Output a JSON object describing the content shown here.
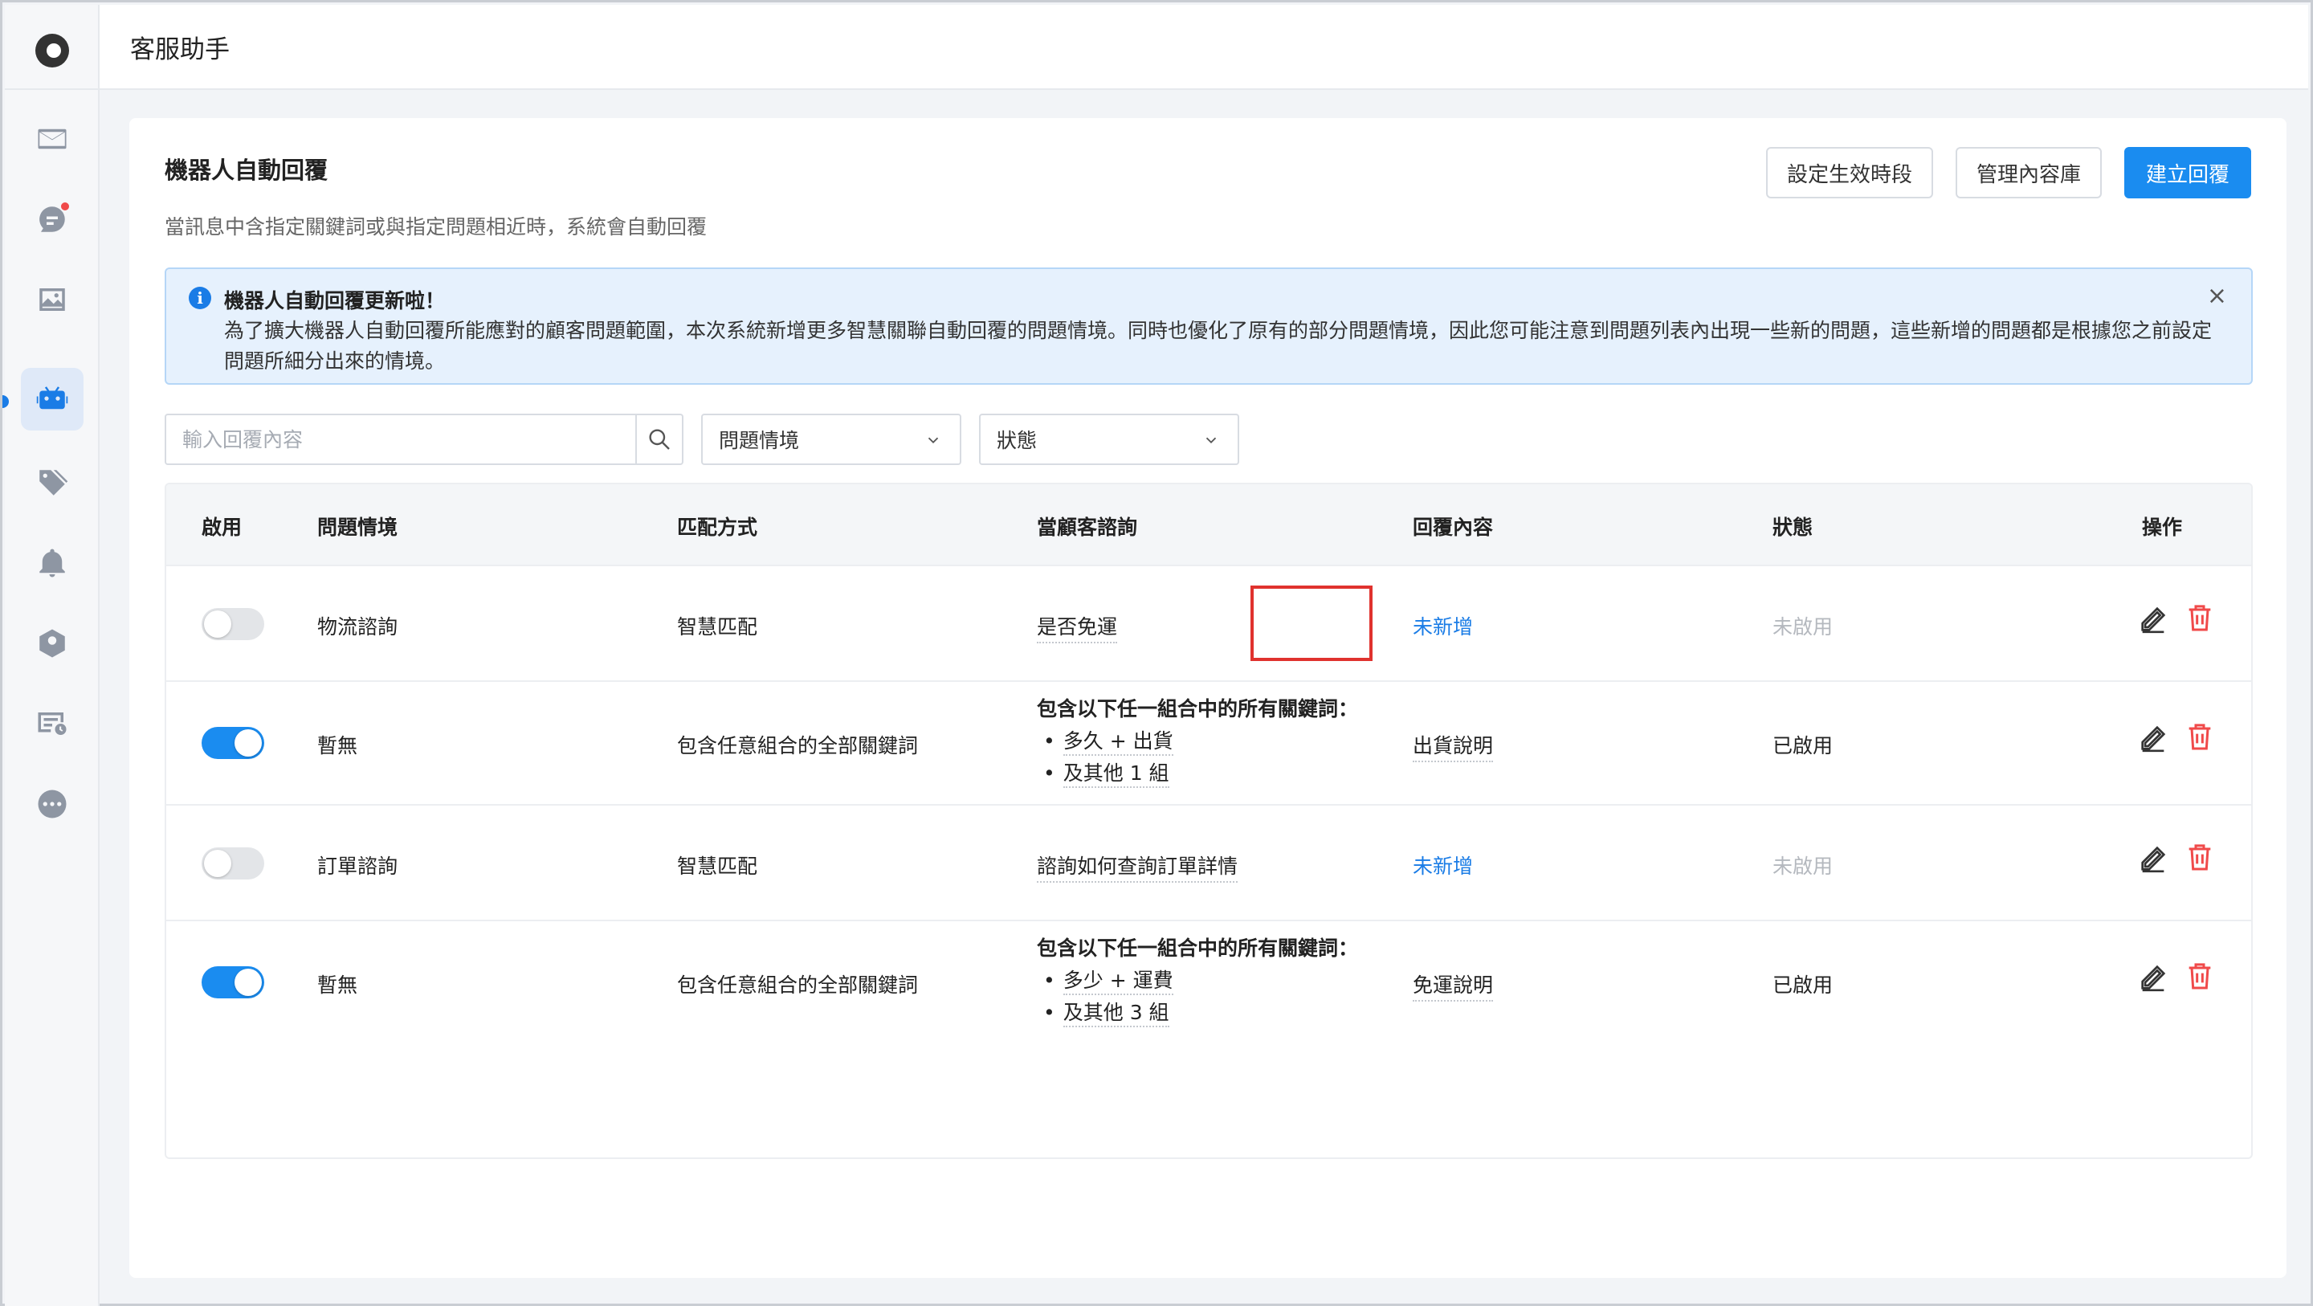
{
  "app": {
    "title": "客服助手"
  },
  "sidebar": {
    "items": [
      {
        "name": "inbox",
        "icon": "mail-icon"
      },
      {
        "name": "chat",
        "icon": "chat-icon",
        "has_badge": true
      },
      {
        "name": "media",
        "icon": "image-icon"
      },
      {
        "name": "bot",
        "icon": "robot-icon",
        "active": true
      },
      {
        "name": "tags",
        "icon": "tag-icon"
      },
      {
        "name": "notifications",
        "icon": "bell-icon"
      },
      {
        "name": "agents",
        "icon": "agent-icon"
      },
      {
        "name": "tickets",
        "icon": "ticket-icon"
      },
      {
        "name": "more",
        "icon": "more-icon"
      }
    ]
  },
  "page": {
    "title": "機器人自動回覆",
    "subtitle": "當訊息中含指定關鍵詞或與指定問題相近時，系統會自動回覆",
    "buttons": {
      "schedule": "設定生效時段",
      "library": "管理內容庫",
      "create": "建立回覆"
    }
  },
  "notice": {
    "title": "機器人自動回覆更新啦！",
    "body": "為了擴大機器人自動回覆所能應對的顧客問題範圍，本次系統新增更多智慧關聯自動回覆的問題情境。同時也優化了原有的部分問題情境，因此您可能注意到問題列表內出現一些新的問題，這些新增的問題都是根據您之前設定問題所細分出來的情境。"
  },
  "filters": {
    "search_placeholder": "輸入回覆內容",
    "scenario_label": "問題情境",
    "status_label": "狀態"
  },
  "table": {
    "headers": {
      "enabled": "啟用",
      "scenario": "問題情境",
      "match": "匹配方式",
      "query": "當顧客諮詢",
      "reply": "回覆內容",
      "status": "狀態",
      "actions": "操作"
    },
    "rows": [
      {
        "enabled": false,
        "scenario": "物流諮詢",
        "match": "智慧匹配",
        "query": "是否免運",
        "reply": "未新增",
        "reply_is_link": true,
        "status": "未啟用"
      },
      {
        "enabled": true,
        "scenario": "暫無",
        "match": "包含任意組合的全部關鍵詞",
        "query_title": "包含以下任一組合中的所有關鍵詞：",
        "query_items": [
          "多久 + 出貨",
          "及其他 1 組"
        ],
        "reply": "出貨說明",
        "reply_is_link": false,
        "status": "已啟用"
      },
      {
        "enabled": false,
        "scenario": "訂單諮詢",
        "match": "智慧匹配",
        "query": "諮詢如何查詢訂單詳情",
        "reply": "未新增",
        "reply_is_link": true,
        "status": "未啟用"
      },
      {
        "enabled": true,
        "scenario": "暫無",
        "match": "包含任意組合的全部關鍵詞",
        "query_title": "包含以下任一組合中的所有關鍵詞：",
        "query_items": [
          "多少 + 運費",
          "及其他 3 組"
        ],
        "reply": "免運說明",
        "reply_is_link": false,
        "status": "已啟用"
      }
    ]
  },
  "colors": {
    "accent": "#1a8cf0",
    "link": "#1a7ce6",
    "danger": "#f04a4a",
    "highlight": "#e0322e"
  }
}
